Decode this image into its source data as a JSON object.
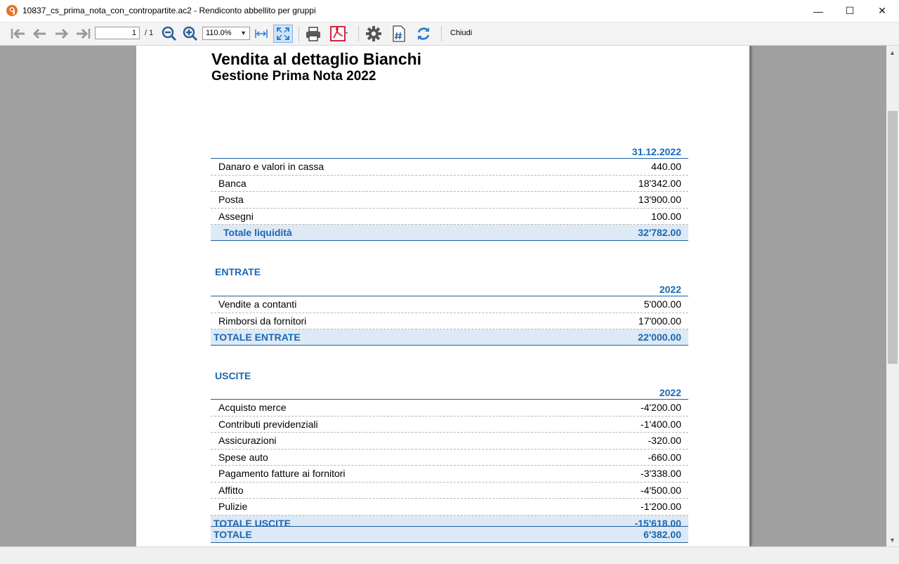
{
  "window": {
    "title": "10837_cs_prima_nota_con_contropartite.ac2 - Rendiconto abbellito per gruppi",
    "minimize": "—",
    "maximize": "☐",
    "close": "✕"
  },
  "toolbar": {
    "page_current": "1",
    "page_total": "/ 1",
    "zoom": "110.0%",
    "close_label": "Chiudi"
  },
  "report": {
    "title": "Vendita al dettaglio Bianchi",
    "subtitle": "Gestione Prima Nota 2022",
    "liquidity": {
      "column_header": "31.12.2022",
      "rows": [
        {
          "label": "Danaro e valori in cassa",
          "value": "440.00"
        },
        {
          "label": "Banca",
          "value": "18'342.00"
        },
        {
          "label": "Posta",
          "value": "13'900.00"
        },
        {
          "label": "Assegni",
          "value": "100.00"
        }
      ],
      "total_label": "Totale liquidità",
      "total_value": "32'782.00"
    },
    "entrate": {
      "section_title": "ENTRATE",
      "column_header": "2022",
      "rows": [
        {
          "label": "Vendite a contanti",
          "value": "5'000.00"
        },
        {
          "label": "Rimborsi da fornitori",
          "value": "17'000.00"
        }
      ],
      "total_label": "TOTALE ENTRATE",
      "total_value": "22'000.00"
    },
    "uscite": {
      "section_title": "USCITE",
      "column_header": "2022",
      "rows": [
        {
          "label": "Acquisto merce",
          "value": "-4'200.00"
        },
        {
          "label": "Contributi previdenziali",
          "value": "-1'400.00"
        },
        {
          "label": "Assicurazioni",
          "value": "-320.00"
        },
        {
          "label": "Spese auto",
          "value": "-660.00"
        },
        {
          "label": "Pagamento fatture ai fornitori",
          "value": "-3'338.00"
        },
        {
          "label": "Affitto",
          "value": "-4'500.00"
        },
        {
          "label": "Pulizie",
          "value": "-1'200.00"
        }
      ],
      "total_label": "TOTALE USCITE",
      "total_value": "-15'618.00"
    },
    "grand_total": {
      "label": "TOTALE",
      "value": "6'382.00"
    }
  },
  "colors": {
    "accent_blue": "#1a67b5",
    "total_bg": "#dde9f5",
    "viewport_bg": "#a0a0a0"
  }
}
